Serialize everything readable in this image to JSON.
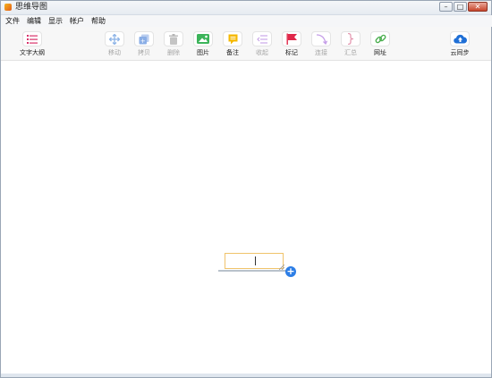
{
  "window": {
    "title": "思维导图"
  },
  "menu": [
    "文件",
    "编辑",
    "显示",
    "帐户",
    "帮助"
  ],
  "toolbar": {
    "outline": "文字大纲",
    "move": "移动",
    "copy": "拷贝",
    "delete": "删除",
    "image": "图片",
    "note": "备注",
    "collapse": "收起",
    "flag": "标记",
    "connect": "连接",
    "summary": "汇总",
    "link": "网址",
    "sync": "云同步"
  },
  "colors": {
    "accent_blue": "#2d7ee6",
    "node_border": "#f0c36b",
    "flag_red": "#e0284a",
    "image_green": "#3cb45a",
    "note_yellow": "#f5b800"
  }
}
